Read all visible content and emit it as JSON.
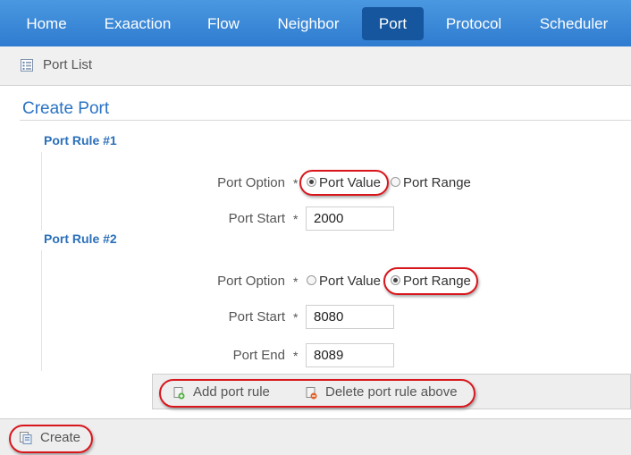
{
  "nav": {
    "items": [
      {
        "label": "Home"
      },
      {
        "label": "Exaaction"
      },
      {
        "label": "Flow"
      },
      {
        "label": "Neighbor"
      },
      {
        "label": "Port"
      },
      {
        "label": "Protocol"
      },
      {
        "label": "Scheduler"
      }
    ],
    "active": "Port"
  },
  "toolbar": {
    "port_list_label": "Port List"
  },
  "page": {
    "title": "Create Port"
  },
  "rules": [
    {
      "heading": "Port Rule #1",
      "port_option_label": "Port Option",
      "option_value_label": "Port Value",
      "option_range_label": "Port Range",
      "selected_option": "Port Value",
      "port_start_label": "Port Start",
      "port_start_value": "2000"
    },
    {
      "heading": "Port Rule #2",
      "port_option_label": "Port Option",
      "option_value_label": "Port Value",
      "option_range_label": "Port Range",
      "selected_option": "Port Range",
      "port_start_label": "Port Start",
      "port_start_value": "8080",
      "port_end_label": "Port End",
      "port_end_value": "8089"
    }
  ],
  "required_marker": "*",
  "rule_actions": {
    "add_label": "Add port rule",
    "delete_label": "Delete port rule above"
  },
  "footer": {
    "create_label": "Create"
  },
  "colors": {
    "nav_bg": "#3a8ad8",
    "nav_active": "#15569e",
    "heading": "#2a6fba",
    "highlight": "#d8161c"
  }
}
